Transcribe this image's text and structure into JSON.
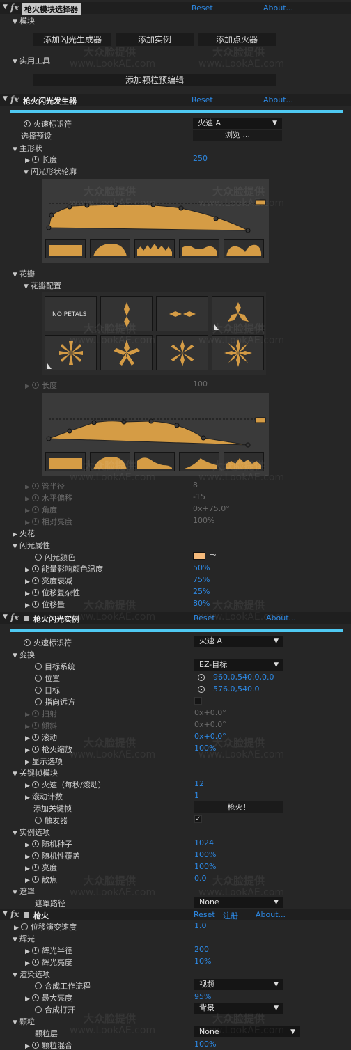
{
  "common": {
    "reset": "Reset",
    "about": "About..."
  },
  "sec1": {
    "title": "枪火模块选择器",
    "modules_label": "模块",
    "buttons": [
      "添加闪光生成器",
      "添加实例",
      "添加点火器"
    ],
    "utils_label": "实用工具",
    "preset_btn": "添加颗粒预编辑"
  },
  "sec2": {
    "title": "枪火闪光发生器",
    "flash_id": {
      "label": "火速标识符",
      "value": "火速 A"
    },
    "preset": {
      "label": "选择预设",
      "button": "浏览 ..."
    },
    "main_shape": "主形状",
    "length": {
      "label": "长度",
      "value": "250"
    },
    "profile_label": "闪光形状轮廓",
    "petals": "花瓣",
    "petal_config": "花瓣配置",
    "no_petals": "NO PETALS",
    "length2": {
      "label": "长度",
      "value": "100"
    },
    "tube_radius": {
      "label": "管半径",
      "value": "8"
    },
    "h_offset": {
      "label": "水平偏移",
      "value": "-15"
    },
    "angle": {
      "label": "角度",
      "value": "0x+75.0°"
    },
    "rel_brightness": {
      "label": "相对亮度",
      "value": "100%"
    },
    "sparks": "火花",
    "flash_props": "闪光属性",
    "flash_color": {
      "label": "闪光颜色",
      "color": "#f4b97a"
    },
    "energy_temp": {
      "label": "能量影响颜色温度",
      "value": "50%"
    },
    "brightness_decay": {
      "label": "亮度衰减",
      "value": "75%"
    },
    "offset_complexity": {
      "label": "位移复杂性",
      "value": "25%"
    },
    "offset_amount": {
      "label": "位移量",
      "value": "80%"
    }
  },
  "sec3": {
    "title": "枪火闪光实例",
    "flash_id": {
      "label": "火速标识符",
      "value": "火速 A"
    },
    "transform": "变换",
    "target_system": {
      "label": "目标系统",
      "value": "EZ-目标"
    },
    "position": {
      "label": "位置",
      "value": "960.0,540.0,0.0"
    },
    "target": {
      "label": "目标",
      "value": "576.0,540.0"
    },
    "point_far": {
      "label": "指向远方"
    },
    "sweep": {
      "label": "扫射",
      "value": "0x+0.0°"
    },
    "tilt": {
      "label": "倾斜",
      "value": "0x+0.0°"
    },
    "roll": {
      "label": "滚动",
      "value": "0x+0.0°"
    },
    "gun_scale": {
      "label": "枪火缩放",
      "value": "100%"
    },
    "display_opts": "显示选项",
    "keyframe_module": "关键帧模块",
    "fire_rate": {
      "label": "火速（每秒/滚动）",
      "value": "12"
    },
    "roll_count": {
      "label": "滚动计数",
      "value": "1"
    },
    "add_keyframe": {
      "label": "添加关键帧",
      "button": "枪火！"
    },
    "trigger": {
      "label": "触发器",
      "check": "✓"
    },
    "instance_opts": "实例选项",
    "random_seed": {
      "label": "随机种子",
      "value": "1024"
    },
    "random_coverage": {
      "label": "随机性覆盖",
      "value": "100%"
    },
    "brightness": {
      "label": "亮度",
      "value": "100%"
    },
    "defocus": {
      "label": "散焦",
      "value": "0.0"
    },
    "mask": "遮罩",
    "mask_path": {
      "label": "遮罩路径",
      "value": "None"
    }
  },
  "sec4": {
    "title": "枪火",
    "register": "注册",
    "offset_speed": {
      "label": "位移演变速度",
      "value": "1.0"
    },
    "glow": "辉光",
    "glow_radius": {
      "label": "辉光半径",
      "value": "200"
    },
    "glow_brightness": {
      "label": "辉光亮度",
      "value": "10%"
    },
    "render_opts": "渲染选项",
    "comp_workflow": {
      "label": "合成工作流程",
      "value": "视频"
    },
    "max_brightness": {
      "label": "最大亮度",
      "value": "95%"
    },
    "comp_on": {
      "label": "合成打开",
      "value": "背景"
    },
    "grain": "颗粒",
    "grain_layer": {
      "label": "颗粒层",
      "value": "None"
    },
    "grain_blend": {
      "label": "颗粒混合",
      "value": "100%"
    }
  },
  "watermark": {
    "cn": "大众脸提供",
    "url": "www.LookAE.com"
  },
  "colors": {
    "accent_bar": "#4fc9f2",
    "shape_fill": "#d59c45",
    "link_blue": "#2d8ae6"
  }
}
